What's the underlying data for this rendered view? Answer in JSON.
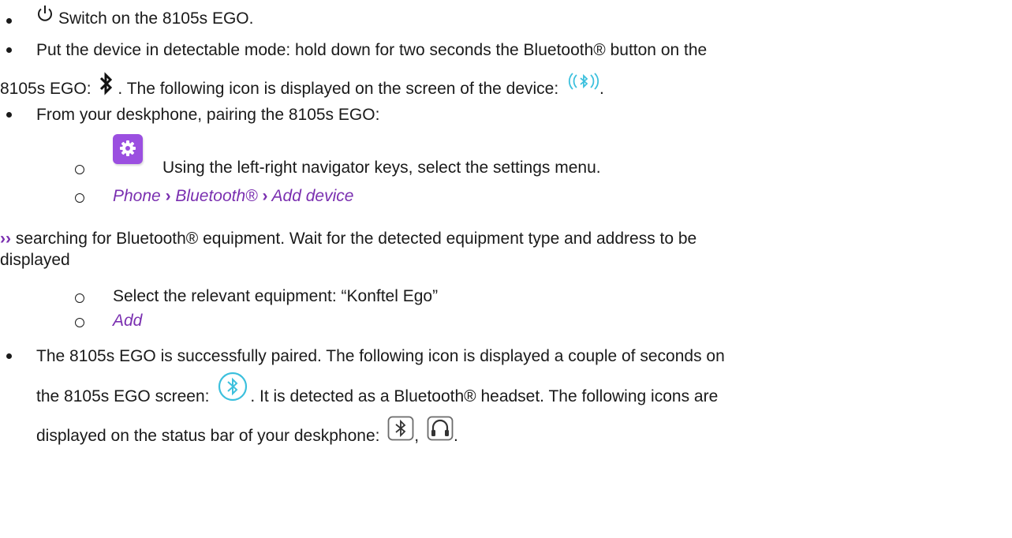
{
  "items": {
    "power": {
      "text": "Switch on the 8105s EGO."
    },
    "detect": {
      "line1": "Put the device in detectable mode: hold down for two seconds the Bluetooth® button on the",
      "line2a": "8105s EGO:",
      "line2b": ". The following icon is displayed on the screen of the device:",
      "line2c": "."
    },
    "pair": {
      "text": "From your deskphone, pairing the 8105s EGO:"
    },
    "settings_step": {
      "text": "Using the left-right navigator keys, select the settings menu."
    },
    "path": {
      "phone": "Phone",
      "bluetooth": "Bluetooth®",
      "add_device": "Add device",
      "separator": "›"
    },
    "searching": {
      "marker": "››",
      "line1": "searching for Bluetooth® equipment. Wait for the detected equipment type and address to be",
      "line2": "displayed"
    },
    "select_step": {
      "text": "Select the relevant equipment: “Konftel Ego”"
    },
    "add_step": {
      "text": "Add"
    },
    "paired": {
      "line1": "The 8105s EGO is successfully paired. The following icon is displayed a couple of seconds on",
      "line2a": "the 8105s EGO screen:",
      "line2b": ". It is detected as a Bluetooth® headset. The following icons are",
      "line3a": "displayed on the status bar of your deskphone:",
      "line3b": ",",
      "line3c": "."
    }
  },
  "icons": {
    "power": "power-icon",
    "bluetooth": "bluetooth-icon",
    "bluetooth_signal": "bluetooth-signal-icon",
    "settings": "gear-icon",
    "bluetooth_circle": "bluetooth-circle-icon",
    "bluetooth_status": "bluetooth-status-icon",
    "headset_status": "headset-icon"
  },
  "colors": {
    "accent_purple": "#7a2fb0",
    "settings_tile": "#9b4fe0",
    "bluetooth_cyan": "#3cc0dd"
  }
}
